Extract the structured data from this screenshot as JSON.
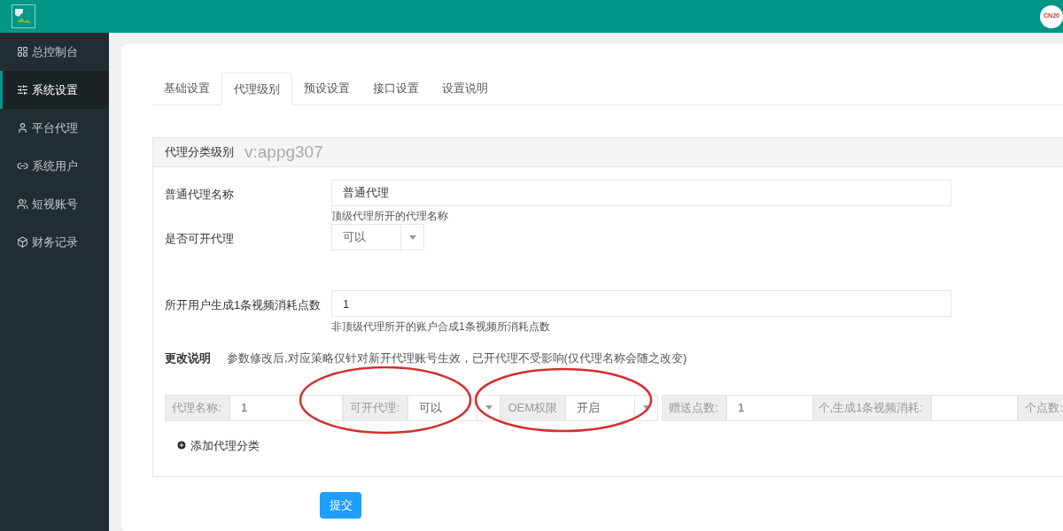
{
  "header": {
    "logo_text": "CN20"
  },
  "sidebar": {
    "items": [
      {
        "label": "总控制台",
        "selected": false
      },
      {
        "label": "系统设置",
        "selected": true
      },
      {
        "label": "平台代理",
        "selected": false
      },
      {
        "label": "系统用户",
        "selected": false
      },
      {
        "label": "短视账号",
        "selected": false
      },
      {
        "label": "财务记录",
        "selected": false
      }
    ]
  },
  "tabs": [
    {
      "label": "基础设置",
      "selected": false
    },
    {
      "label": "代理级别",
      "selected": true
    },
    {
      "label": "预设设置",
      "selected": false
    },
    {
      "label": "接口设置",
      "selected": false
    },
    {
      "label": "设置说明",
      "selected": false
    }
  ],
  "panel": {
    "title": "代理分类级别",
    "watermark": "v:appg307",
    "rows": [
      {
        "kind": "input",
        "label": "普通代理名称",
        "value": "普通代理",
        "hint": "顶级代理所开的代理名称"
      },
      {
        "kind": "select",
        "label": "是否可开代理",
        "value": "可以"
      },
      {
        "kind": "input",
        "label": "所开用户生成1条视频消耗点数",
        "value": "1",
        "hint": "非顶级代理所开的账户合成1条视频所消耗点数"
      }
    ],
    "note": {
      "label": "更改说明",
      "text": "参数修改后,对应策略仅针对新开代理账号生效，已开代理不受影响(仅代理名称会随之改变)"
    },
    "category_row": [
      {
        "kind": "label",
        "text": "代理名称:"
      },
      {
        "kind": "input",
        "value": "1"
      },
      {
        "kind": "label",
        "text": "可开代理:"
      },
      {
        "kind": "select",
        "value": "可以"
      },
      {
        "kind": "label",
        "text": "OEM权限"
      },
      {
        "kind": "select",
        "value": "开启"
      },
      {
        "kind": "label",
        "text": "赠送点数:"
      },
      {
        "kind": "input",
        "value": "1"
      },
      {
        "kind": "label",
        "text": "个,生成1条视频消耗:"
      },
      {
        "kind": "input"
      },
      {
        "kind": "label",
        "text": "个点数:"
      }
    ],
    "add_button": "添加代理分类"
  },
  "submit": "提交"
}
